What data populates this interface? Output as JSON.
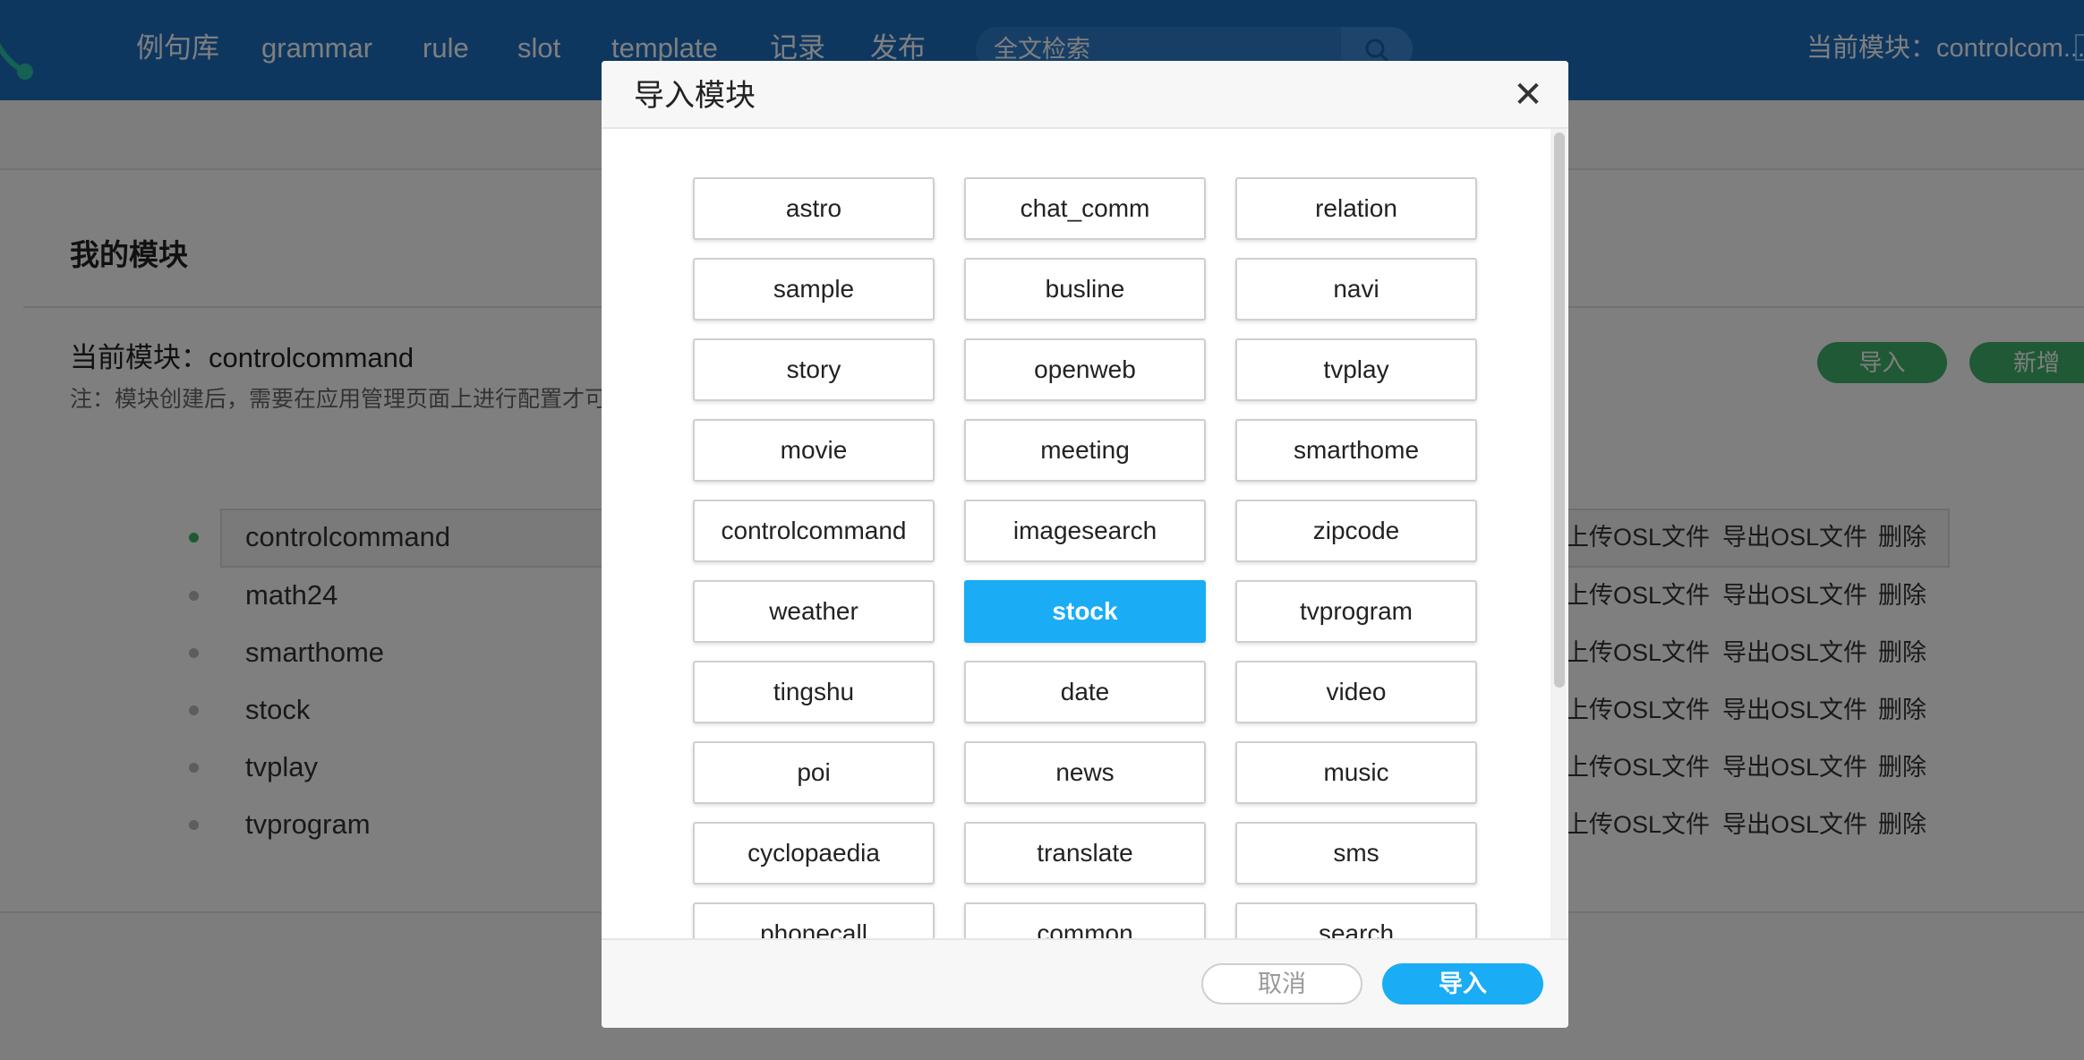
{
  "nav": {
    "items": [
      "例句库",
      "grammar",
      "rule",
      "slot",
      "template",
      "记录",
      "发布"
    ],
    "search_placeholder": "全文检索",
    "current_module": "当前模块：controlcom..."
  },
  "page": {
    "section_title": "我的模块",
    "current_module": "当前模块：controlcommand",
    "note": "注：模块创建后，需要在应用管理页面上进行配置才可",
    "import_button": "导入",
    "new_button": "新增",
    "modules": [
      {
        "name": "controlcommand",
        "active": true
      },
      {
        "name": "math24",
        "active": false
      },
      {
        "name": "smarthome",
        "active": false
      },
      {
        "name": "stock",
        "active": false
      },
      {
        "name": "tvplay",
        "active": false
      },
      {
        "name": "tvprogram",
        "active": false
      }
    ],
    "row_actions": [
      "上传OSL文件",
      "导出OSL文件",
      "删除"
    ]
  },
  "modal": {
    "title": "导入模块",
    "close": "✕",
    "modules": [
      "astro",
      "chat_comm",
      "relation",
      "sample",
      "busline",
      "navi",
      "story",
      "openweb",
      "tvplay",
      "movie",
      "meeting",
      "smarthome",
      "controlcommand",
      "imagesearch",
      "zipcode",
      "weather",
      "stock",
      "tvprogram",
      "tingshu",
      "date",
      "video",
      "poi",
      "news",
      "music",
      "cyclopaedia",
      "translate",
      "sms",
      "phonecall",
      "common",
      "search"
    ],
    "selected": "stock",
    "cancel": "取消",
    "confirm": "导入"
  },
  "colors": {
    "nav_bg": "#1d6fc0",
    "accent_green": "#3fb36a",
    "accent_blue": "#1aacf5"
  }
}
